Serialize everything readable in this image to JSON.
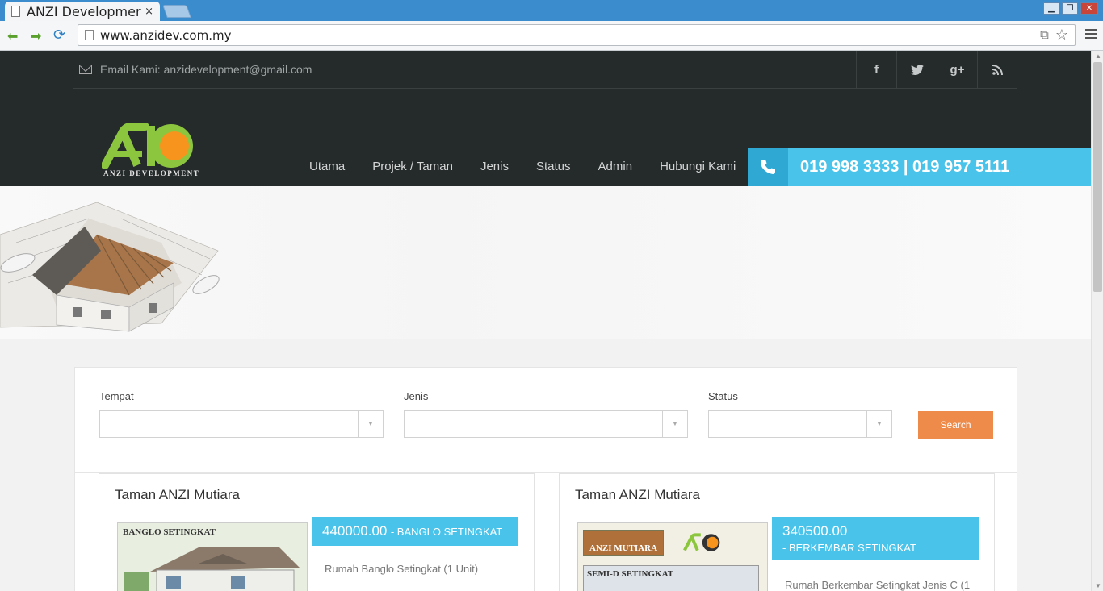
{
  "browser": {
    "tab_title": "ANZI Developmer",
    "tab_close": "×",
    "url": "www.anzidev.com.my"
  },
  "topbar": {
    "email_text": "Email Kami: anzidevelopment@gmail.com",
    "social": [
      "f",
      "t",
      "g+",
      "rss"
    ]
  },
  "brand": {
    "logo_text": "ANZI DEVELOPMENT",
    "colors": {
      "green": "#8cc63f",
      "orange": "#f7941d"
    }
  },
  "nav": {
    "items": [
      "Utama",
      "Projek / Taman",
      "Jenis",
      "Status",
      "Admin",
      "Hubungi Kami"
    ]
  },
  "phone": {
    "text": "019 998 3333 | 019 957 5111",
    "accent": "#49c3ea"
  },
  "search": {
    "fields": [
      {
        "label": "Tempat",
        "value": ""
      },
      {
        "label": "Jenis",
        "value": ""
      },
      {
        "label": "Status",
        "value": ""
      }
    ],
    "button_label": "Search",
    "button_color": "#ee8a4a"
  },
  "listings": [
    {
      "name": "Taman ANZI Mutiara",
      "price": "440000.00",
      "type": "- BANGLO SETINGKAT",
      "description": "Rumah Banglo Setingkat (1 Unit)",
      "thumb_heading": "BANGLO SETINGKAT"
    },
    {
      "name": "Taman ANZI Mutiara",
      "price": "340500.00",
      "type": "- BERKEMBAR SETINGKAT",
      "description": "Rumah Berkembar Setingkat Jenis C (1",
      "thumb_heading": "SEMI-D SETINGKAT",
      "thumb_banner": "ANZI MUTIARA"
    }
  ]
}
